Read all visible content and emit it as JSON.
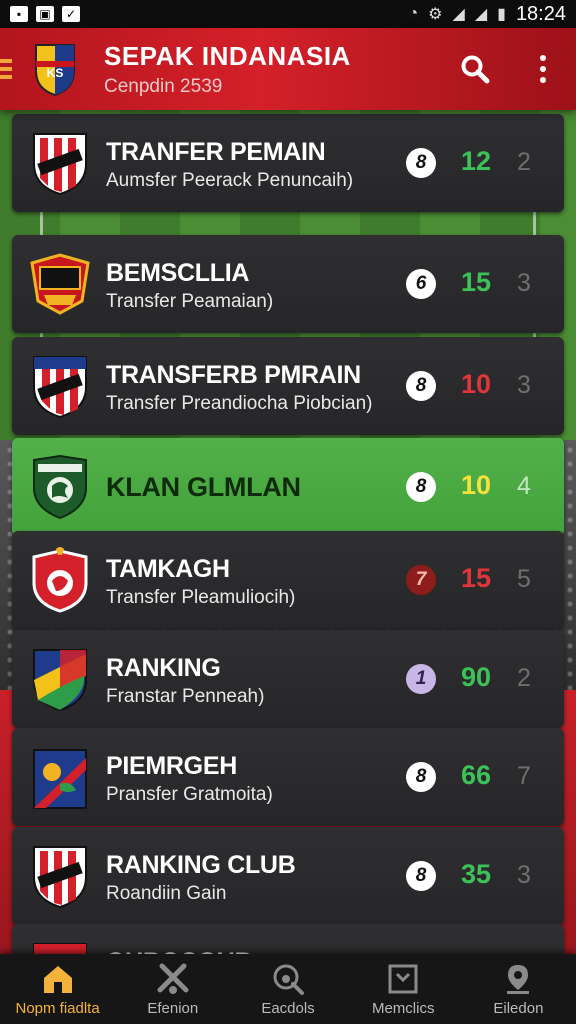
{
  "status_bar": {
    "time": "18:24"
  },
  "header": {
    "title": "SEPAK INDANASIA",
    "subtitle": "Cenpdin 2539",
    "menu_icon": "hamburger-icon",
    "search_icon": "search-icon",
    "more_icon": "more-vertical-icon"
  },
  "rows": [
    {
      "title": "TRANFER PEMAIN",
      "subtitle": "Aumsfer Peerack Penuncaih)",
      "badge": "8",
      "score": "12",
      "rank": "2"
    },
    {
      "title": "BEMSCLLIA",
      "subtitle": "Transfer Peamaian)",
      "badge": "6",
      "score": "15",
      "rank": "3"
    },
    {
      "title": "TRANSFERB PMRAIN",
      "subtitle": "Transfer Preandiocha Piobcian)",
      "badge": "8",
      "score": "10",
      "rank": "3"
    },
    {
      "title": "KLAN GLMLAN",
      "subtitle": "",
      "badge": "8",
      "score": "10",
      "rank": "4"
    },
    {
      "title": "TAMKAGH",
      "subtitle": "Transfer Pleamuliocih)",
      "badge": "7",
      "score": "15",
      "rank": "5"
    },
    {
      "title": "RANKING",
      "subtitle": "Franstar Penneah)",
      "badge": "1",
      "score": "90",
      "rank": "2"
    },
    {
      "title": "PIEMRGEH",
      "subtitle": "Pransfer Gratmoita)",
      "badge": "8",
      "score": "66",
      "rank": "7"
    },
    {
      "title": "RANKING CLUB",
      "subtitle": "Roandiin Gain",
      "badge": "8",
      "score": "35",
      "rank": "3"
    },
    {
      "title": "OUBOCGUB",
      "subtitle": "",
      "badge": "",
      "score": "",
      "rank": ""
    }
  ],
  "colors": {
    "header_red": "#d42029",
    "active_row": "#4caf45",
    "score_green": "#3cc256",
    "score_red": "#e0363a",
    "score_yellow": "#f6e23b",
    "nav_active": "#f3b23a"
  },
  "nav": [
    {
      "label": "Nopm fiadlta",
      "icon": "home-icon"
    },
    {
      "label": "Efenion",
      "icon": "tools-icon"
    },
    {
      "label": "Eacdols",
      "icon": "scout-icon"
    },
    {
      "label": "Memclics",
      "icon": "stats-icon"
    },
    {
      "label": "Eiledon",
      "icon": "location-icon"
    }
  ]
}
